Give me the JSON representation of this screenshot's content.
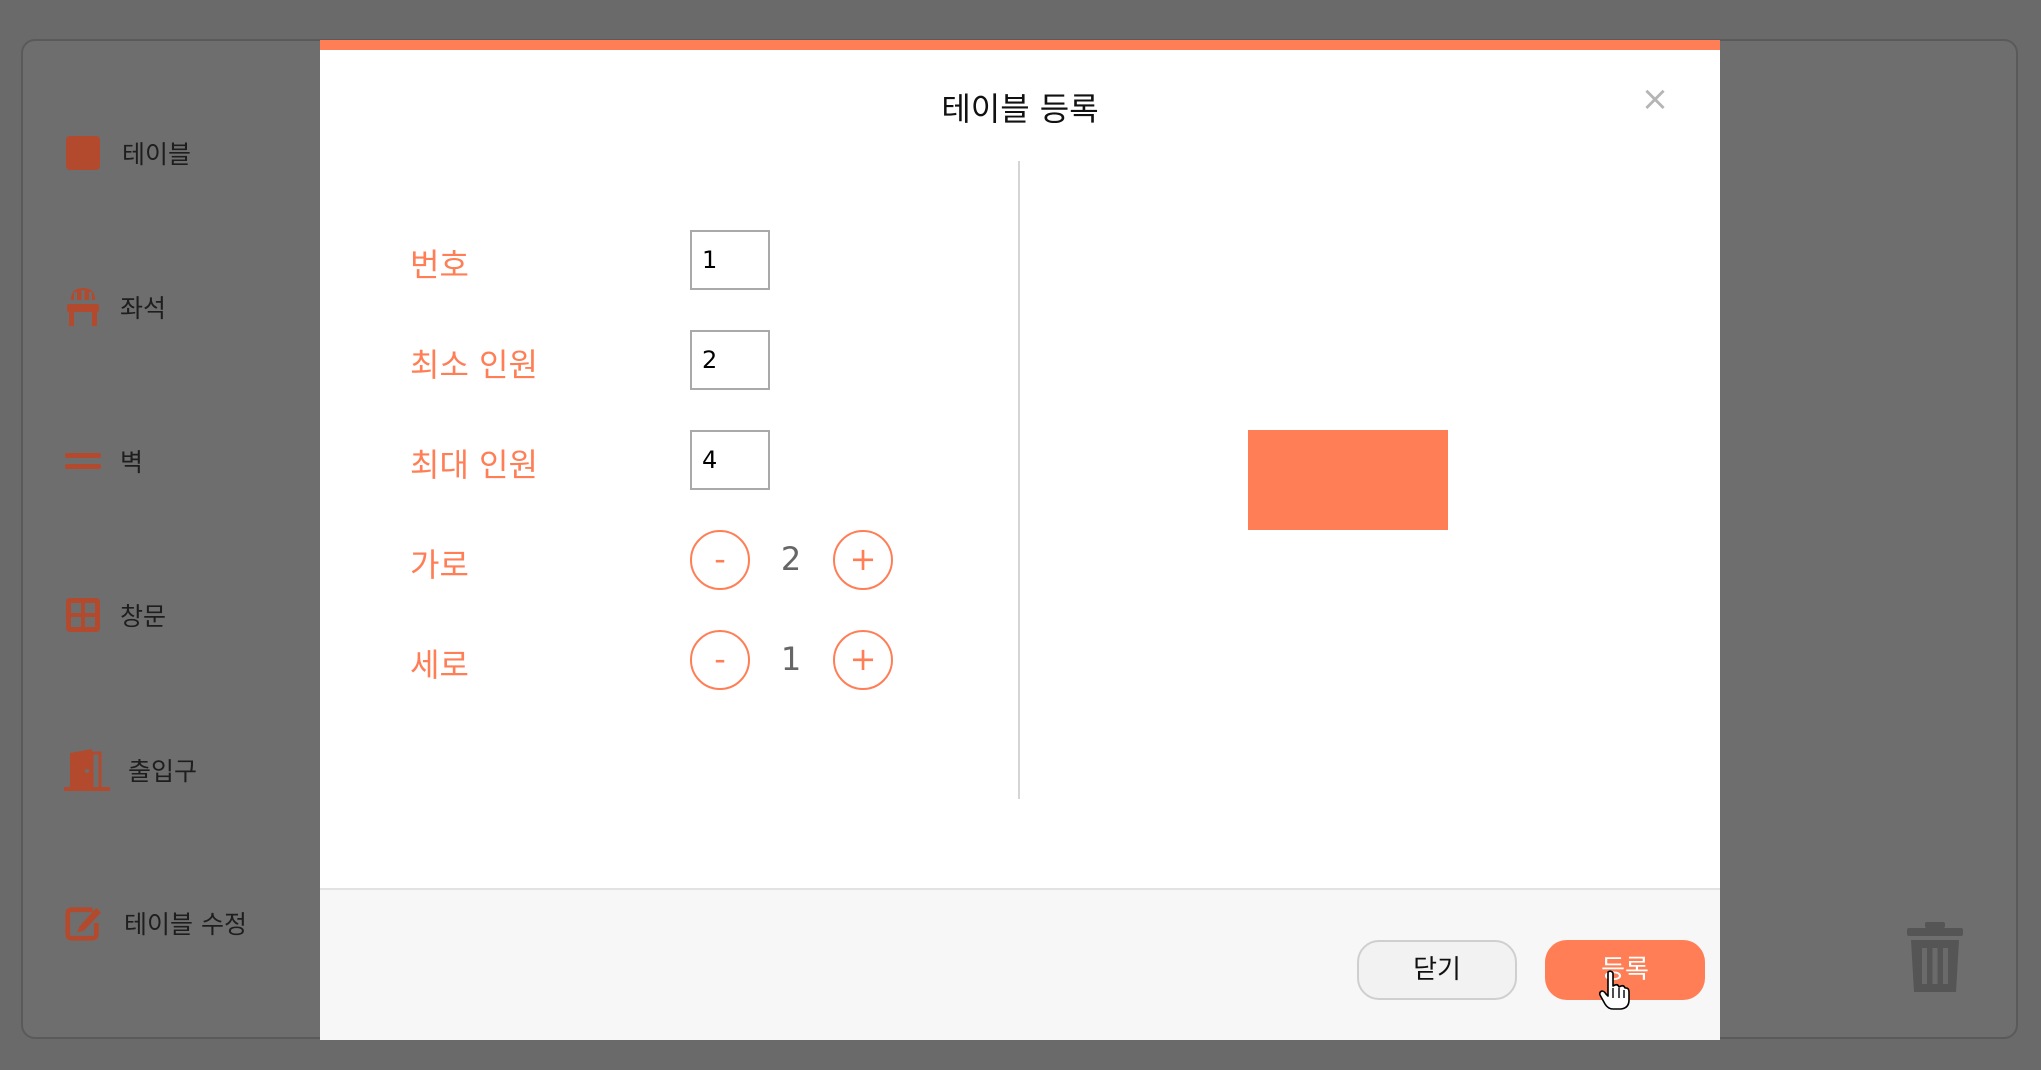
{
  "sidebar": {
    "items": [
      {
        "label": "테이블",
        "icon": "table-square-icon"
      },
      {
        "label": "좌석",
        "icon": "chair-icon"
      },
      {
        "label": "벽",
        "icon": "wall-lines-icon"
      },
      {
        "label": "창문",
        "icon": "window-grid-icon"
      },
      {
        "label": "출입구",
        "icon": "door-icon"
      },
      {
        "label": "테이블 수정",
        "icon": "edit-icon"
      }
    ]
  },
  "colors": {
    "accent": "#ff7e55",
    "sidebar_icon": "#b34a2e",
    "overlay": "#6a6a6a"
  },
  "modal": {
    "title": "테이블 등록",
    "close_symbol": "×",
    "fields": {
      "number": {
        "label": "번호",
        "value": "1"
      },
      "min_people": {
        "label": "최소 인원",
        "value": "2"
      },
      "max_people": {
        "label": "최대 인원",
        "value": "4"
      },
      "width": {
        "label": "가로",
        "value": "2",
        "minus": "-",
        "plus": "+"
      },
      "height": {
        "label": "세로",
        "value": "1",
        "minus": "-",
        "plus": "+"
      }
    },
    "footer": {
      "close_label": "닫기",
      "submit_label": "등록"
    }
  }
}
